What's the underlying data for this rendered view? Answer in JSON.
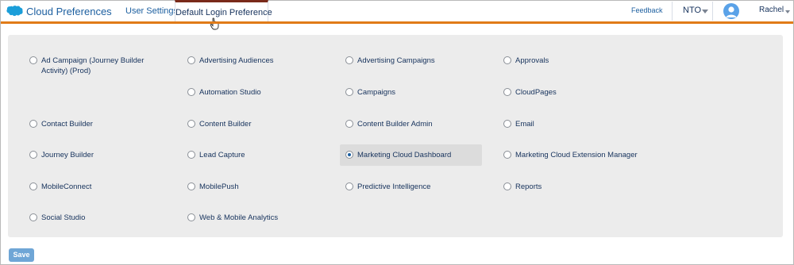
{
  "header": {
    "app_name": "Cloud Preferences",
    "tabs": [
      {
        "label": "User Settings",
        "active": false
      },
      {
        "label": "Default Login Preference",
        "active": true
      }
    ],
    "feedback_label": "Feedback",
    "org": "NTO",
    "user": "Rachel"
  },
  "colors": {
    "accent_bar": "#e07b18",
    "brand": "#1b5e9f",
    "panel_bg": "#ececec",
    "save_button": "#6fa6d6"
  },
  "options": {
    "ad_campaign": "Ad Campaign (Journey Builder Activity) (Prod)",
    "advertising_audiences": "Advertising Audiences",
    "advertising_campaigns": "Advertising Campaigns",
    "approvals": "Approvals",
    "automation_studio": "Automation Studio",
    "campaigns": "Campaigns",
    "cloudpages": "CloudPages",
    "contact_builder": "Contact Builder",
    "content_builder": "Content Builder",
    "content_builder_admin": "Content Builder Admin",
    "email": "Email",
    "journey_builder": "Journey Builder",
    "lead_capture": "Lead Capture",
    "marketing_cloud_dashboard": "Marketing Cloud Dashboard",
    "marketing_cloud_extension_manager": "Marketing Cloud Extension Manager",
    "mobileconnect": "MobileConnect",
    "mobilepush": "MobilePush",
    "predictive_intelligence": "Predictive Intelligence",
    "reports": "Reports",
    "social_studio": "Social Studio",
    "web_mobile_analytics": "Web & Mobile Analytics"
  },
  "selected_option": "Marketing Cloud Dashboard",
  "footer": {
    "save_label": "Save"
  }
}
